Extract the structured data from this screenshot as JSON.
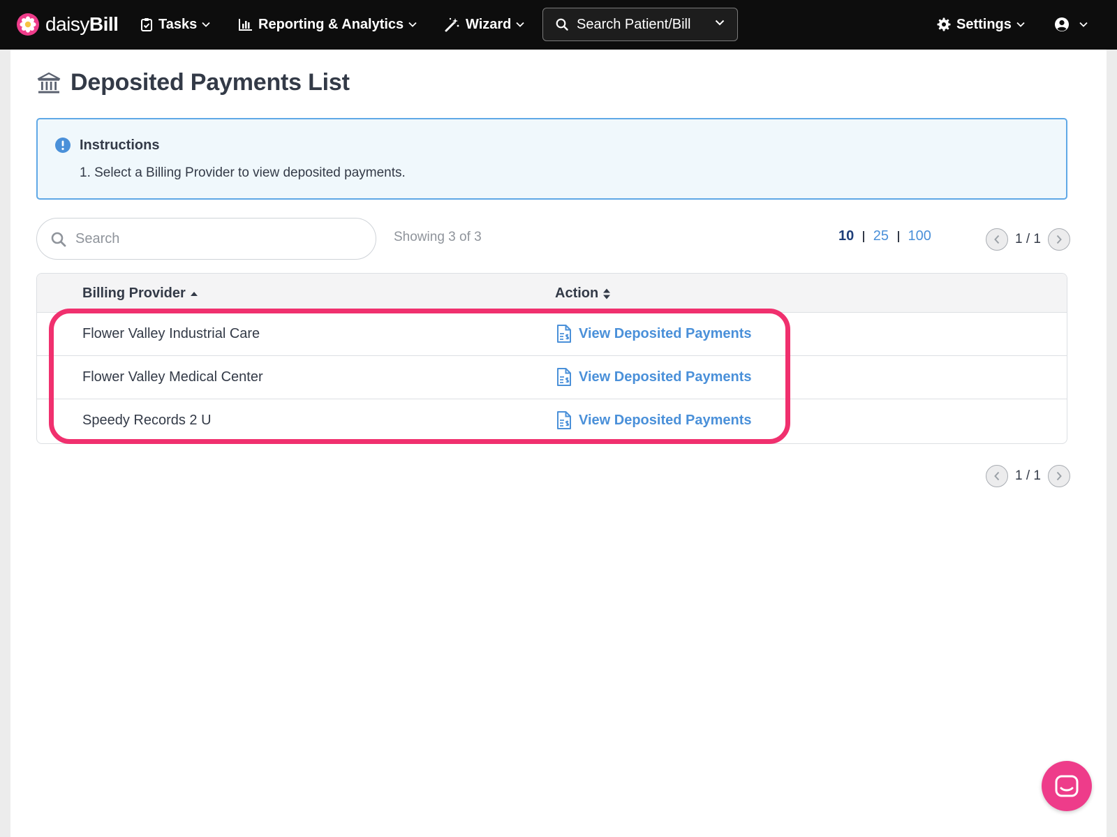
{
  "topnav": {
    "brand": {
      "light": "daisy",
      "bold": "Bill"
    },
    "tasks_label": "Tasks",
    "reporting_label": "Reporting & Analytics",
    "wizard_label": "Wizard",
    "search_label": "Search Patient/Bill",
    "settings_label": "Settings"
  },
  "page": {
    "title": "Deposited Payments List"
  },
  "instructions": {
    "title": "Instructions",
    "step": "1. Select a Billing Provider to view deposited payments."
  },
  "toolbar": {
    "search_placeholder": "Search",
    "search_value": "",
    "showing": "Showing 3 of 3",
    "page_sizes": [
      "10",
      "25",
      "100"
    ],
    "page_size_selected": "10",
    "pager_text": "1 / 1"
  },
  "table": {
    "columns": [
      "Billing Provider",
      "Action"
    ],
    "rows": [
      {
        "provider": "Flower Valley Industrial Care",
        "action": "View Deposited Payments"
      },
      {
        "provider": "Flower Valley Medical Center",
        "action": "View Deposited Payments"
      },
      {
        "provider": "Speedy Records 2 U",
        "action": "View Deposited Payments"
      }
    ]
  },
  "bottom_pager": {
    "text": "1 / 1"
  },
  "colors": {
    "nav_bg": "#0d0d0d",
    "link": "#4a90d9",
    "highlight": "#f0306e",
    "chat": "#ee3c8a",
    "info_border": "#5fa8e6"
  },
  "icons": {
    "brand": "flower-icon",
    "tasks": "clipboard-check-icon",
    "reporting": "bar-chart-icon",
    "wizard": "magic-wand-icon",
    "search": "search-icon",
    "settings": "gear-icon",
    "user": "user-circle-icon",
    "title": "bank-icon",
    "info": "info-circle-icon",
    "action": "file-invoice-dollar-icon",
    "chat": "chat-icon"
  }
}
